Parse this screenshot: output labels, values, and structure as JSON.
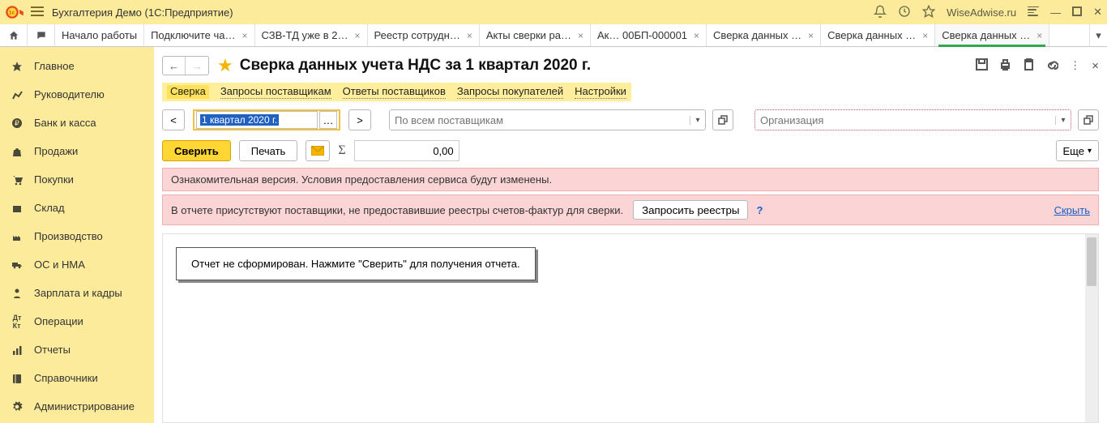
{
  "titlebar": {
    "app_title": "Бухгалтерия Демо  (1С:Предприятие)",
    "site": "WiseAdwise.ru"
  },
  "tabs": [
    {
      "label": "Начало работы",
      "closable": false
    },
    {
      "label": "Подключите ча…",
      "closable": true
    },
    {
      "label": "СЗВ-ТД уже в 2…",
      "closable": true
    },
    {
      "label": "Реестр сотрудн…",
      "closable": true
    },
    {
      "label": "Акты сверки ра…",
      "closable": true
    },
    {
      "label": "Ак… 00БП-000001",
      "closable": true
    },
    {
      "label": "Сверка данных …",
      "closable": true
    },
    {
      "label": "Сверка данных …",
      "closable": true
    },
    {
      "label": "Сверка данных …",
      "closable": true,
      "active": true
    }
  ],
  "sidebar": [
    {
      "icon": "star",
      "label": "Главное"
    },
    {
      "icon": "chart",
      "label": "Руководителю"
    },
    {
      "icon": "ruble",
      "label": "Банк и касса"
    },
    {
      "icon": "bag",
      "label": "Продажи"
    },
    {
      "icon": "cart",
      "label": "Покупки"
    },
    {
      "icon": "box",
      "label": "Склад"
    },
    {
      "icon": "factory",
      "label": "Производство"
    },
    {
      "icon": "truck",
      "label": "ОС и НМА"
    },
    {
      "icon": "person",
      "label": "Зарплата и кадры"
    },
    {
      "icon": "dtkt",
      "label": "Операции"
    },
    {
      "icon": "bars",
      "label": "Отчеты"
    },
    {
      "icon": "book",
      "label": "Справочники"
    },
    {
      "icon": "gear",
      "label": "Администрирование"
    }
  ],
  "form": {
    "title": "Сверка данных учета НДС за 1 квартал 2020 г.",
    "subtabs": [
      "Сверка",
      "Запросы поставщикам",
      "Ответы поставщиков",
      "Запросы покупателей",
      "Настройки"
    ],
    "period": "1 квартал 2020 г.",
    "supplier_placeholder": "По всем поставщикам",
    "org_placeholder": "Организация",
    "verify_label": "Сверить",
    "print_label": "Печать",
    "sum_value": "0,00",
    "more_label": "Еще",
    "info1": "Ознакомительная версия. Условия предоставления сервиса будут изменены.",
    "info2": "В отчете присутствуют поставщики, не предоставившие реестры счетов-фактур для сверки.",
    "request_btn": "Запросить реестры",
    "hide_link": "Скрыть",
    "report_msg": "Отчет не сформирован. Нажмите \"Сверить\" для получения отчета."
  }
}
